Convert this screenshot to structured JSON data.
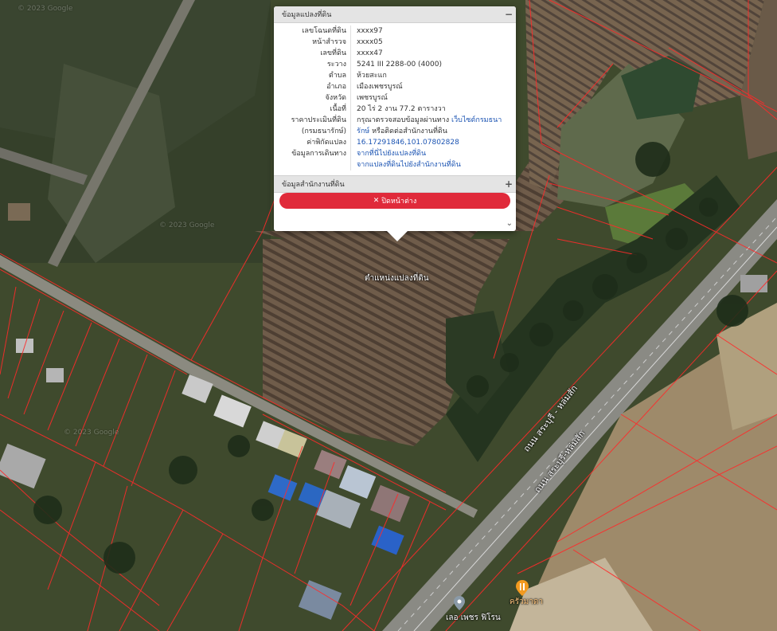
{
  "popup": {
    "land_section_title": "ข้อมูลแปลงที่ดิน",
    "collapse_icon": "minus-icon",
    "fields": [
      {
        "key": "เลขโฉนดที่ดิน",
        "value": "xxxx97"
      },
      {
        "key": "หน้าสำรวจ",
        "value": "xxxx05"
      },
      {
        "key": "เลขที่ดิน",
        "value": "xxxx47"
      },
      {
        "key": "ระวาง",
        "value": "5241 III 2288-00 (4000)"
      },
      {
        "key": "ตำบล",
        "value": "ห้วยสะแก"
      },
      {
        "key": "อำเภอ",
        "value": "เมืองเพชรบูรณ์"
      },
      {
        "key": "จังหวัด",
        "value": "เพชรบูรณ์"
      },
      {
        "key": "เนื้อที่",
        "value": "20 ไร่ 2 งาน 77.2 ตารางวา"
      }
    ],
    "price": {
      "key1": "ราคาประเมินที่ดิน",
      "key2": "(กรมธนารักษ์)",
      "text1": "กรุณาตรวจสอบข้อมูลผ่านทาง",
      "link1": "เว็บไซต์กรมธนา",
      "link2": "รักษ์",
      "text2": "หรือติดต่อสำนักงานที่ดิน"
    },
    "coords": {
      "key": "ค่าพิกัดแปลง",
      "value": "16.17291846,101.07802828"
    },
    "route": {
      "key": "ข้อมูลการเดินทาง",
      "link1": "จากที่นี่ไปยังแปลงที่ดิน",
      "link2": "จากแปลงที่ดินไปยังสำนักงานที่ดิน"
    },
    "office_section_title": "ข้อมูลสำนักงานที่ดิน",
    "expand_icon": "plus-icon",
    "close_label": "ปิดหน้าต่าง",
    "close_icon": "close-icon"
  },
  "map": {
    "parcel_label": "ตำแหน่งแปลงที่ดิน",
    "road_label_1": "ถนน สระบุรี - หล่มสัก",
    "road_label_2": "ถนน สระบุรี-หล่มสัก",
    "poi_1": "ครัวมาดา",
    "poi_2": "เลอ เพชร ฟิโรน",
    "watermarks": [
      "© 2023 Google",
      "© 2023 Google",
      "© 2023 Google"
    ],
    "colors": {
      "parcel_boundary": "#ff2a2a",
      "popup_button": "#e02a3a",
      "link": "#1d55b3"
    }
  }
}
